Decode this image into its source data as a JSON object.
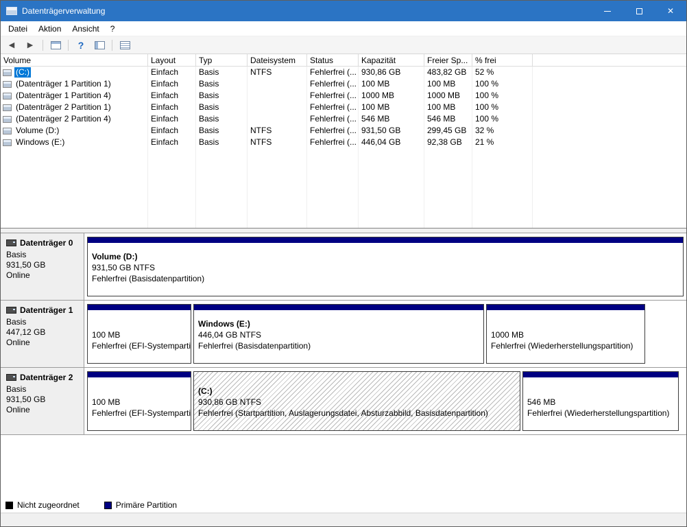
{
  "window": {
    "title": "Datenträgerverwaltung",
    "controls": [
      "minimize",
      "maximize",
      "close"
    ]
  },
  "menubar": {
    "items": [
      "Datei",
      "Aktion",
      "Ansicht",
      "?"
    ]
  },
  "toolbar": {
    "icons": [
      "back-arrow",
      "forward-arrow",
      "console-tree",
      "help",
      "disk-view",
      "properties"
    ]
  },
  "volume_list": {
    "columns": [
      "Volume",
      "Layout",
      "Typ",
      "Dateisystem",
      "Status",
      "Kapazität",
      "Freier Sp...",
      "% frei"
    ],
    "rows": [
      {
        "volume": "(C:)",
        "layout": "Einfach",
        "typ": "Basis",
        "fs": "NTFS",
        "status": "Fehlerfrei (...",
        "capacity": "930,86 GB",
        "free": "483,82 GB",
        "pct_free": "52 %",
        "selected": true
      },
      {
        "volume": "(Datenträger 1 Partition 1)",
        "layout": "Einfach",
        "typ": "Basis",
        "fs": "",
        "status": "Fehlerfrei (...",
        "capacity": "100 MB",
        "free": "100 MB",
        "pct_free": "100 %",
        "selected": false
      },
      {
        "volume": "(Datenträger 1 Partition 4)",
        "layout": "Einfach",
        "typ": "Basis",
        "fs": "",
        "status": "Fehlerfrei (...",
        "capacity": "1000 MB",
        "free": "1000 MB",
        "pct_free": "100 %",
        "selected": false
      },
      {
        "volume": "(Datenträger 2 Partition 1)",
        "layout": "Einfach",
        "typ": "Basis",
        "fs": "",
        "status": "Fehlerfrei (...",
        "capacity": "100 MB",
        "free": "100 MB",
        "pct_free": "100 %",
        "selected": false
      },
      {
        "volume": "(Datenträger 2 Partition 4)",
        "layout": "Einfach",
        "typ": "Basis",
        "fs": "",
        "status": "Fehlerfrei (...",
        "capacity": "546 MB",
        "free": "546 MB",
        "pct_free": "100 %",
        "selected": false
      },
      {
        "volume": "Volume (D:)",
        "layout": "Einfach",
        "typ": "Basis",
        "fs": "NTFS",
        "status": "Fehlerfrei (...",
        "capacity": "931,50 GB",
        "free": "299,45 GB",
        "pct_free": "32 %",
        "selected": false
      },
      {
        "volume": "Windows (E:)",
        "layout": "Einfach",
        "typ": "Basis",
        "fs": "NTFS",
        "status": "Fehlerfrei (...",
        "capacity": "446,04 GB",
        "free": "92,38 GB",
        "pct_free": "21 %",
        "selected": false
      }
    ]
  },
  "disk_view": {
    "disks": [
      {
        "name": "Datenträger 0",
        "type": "Basis",
        "size": "931,50 GB",
        "status": "Online",
        "partitions": [
          {
            "title": "Volume (D:)",
            "detail": "931,50 GB NTFS",
            "status": "Fehlerfrei (Basisdatenpartition)",
            "selected": false
          }
        ]
      },
      {
        "name": "Datenträger 1",
        "type": "Basis",
        "size": "447,12 GB",
        "status": "Online",
        "partitions": [
          {
            "title": "",
            "detail": "100 MB",
            "status": "Fehlerfrei (EFI-Systempartition)",
            "selected": false
          },
          {
            "title": "Windows (E:)",
            "detail": "446,04 GB NTFS",
            "status": "Fehlerfrei (Basisdatenpartition)",
            "selected": false
          },
          {
            "title": "",
            "detail": "1000 MB",
            "status": "Fehlerfrei (Wiederherstellungspartition)",
            "selected": false
          }
        ]
      },
      {
        "name": "Datenträger 2",
        "type": "Basis",
        "size": "931,50 GB",
        "status": "Online",
        "partitions": [
          {
            "title": "",
            "detail": "100 MB",
            "status": "Fehlerfrei (EFI-Systempartition)",
            "selected": false
          },
          {
            "title": "(C:)",
            "detail": "930,86 GB NTFS",
            "status": "Fehlerfrei (Startpartition, Auslagerungsdatei, Absturzabbild, Basisdatenpartition)",
            "selected": true
          },
          {
            "title": "",
            "detail": "546 MB",
            "status": "Fehlerfrei (Wiederherstellungspartition)",
            "selected": false
          }
        ]
      }
    ]
  },
  "legend": {
    "items": [
      {
        "label": "Nicht zugeordnet",
        "color": "#000000"
      },
      {
        "label": "Primäre Partition",
        "color": "#000082"
      }
    ]
  },
  "colors": {
    "titlebar": "#2b74c4",
    "selection": "#0078d7",
    "primary_partition_band": "#000082"
  }
}
